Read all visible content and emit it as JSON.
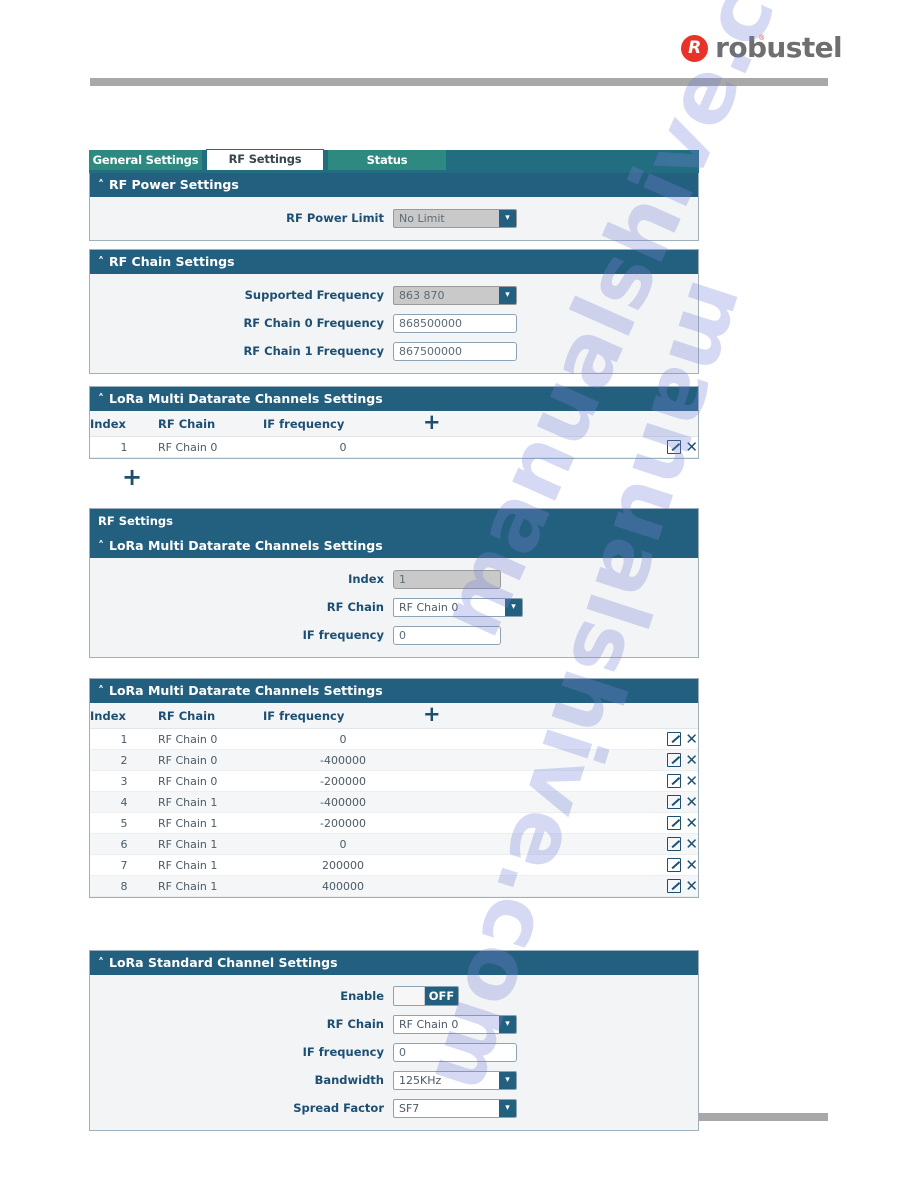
{
  "brand": {
    "name": "robustel",
    "mark_glyph": "R",
    "registered": "®"
  },
  "tabs": [
    {
      "label": "General Settings",
      "active": false
    },
    {
      "label": "RF Settings",
      "active": true
    },
    {
      "label": "Status",
      "active": false
    }
  ],
  "rf_power_settings": {
    "title": "RF Power Settings",
    "caret": "˄",
    "fields": [
      {
        "label": "RF Power Limit",
        "value": "No Limit",
        "type": "select",
        "disabled": true
      }
    ]
  },
  "rf_chain_settings": {
    "title": "RF Chain Settings",
    "caret": "˄",
    "fields": [
      {
        "label": "Supported Frequency",
        "value": "863 870",
        "type": "select",
        "disabled": true
      },
      {
        "label": "RF Chain 0 Frequency",
        "value": "868500000",
        "type": "text",
        "disabled": false
      },
      {
        "label": "RF Chain 1 Frequency",
        "value": "867500000",
        "type": "text",
        "disabled": false
      }
    ]
  },
  "multi_datarate_table_1": {
    "title": "LoRa Multi Datarate Channels Settings",
    "caret": "˄",
    "columns": [
      "Index",
      "RF Chain",
      "IF frequency"
    ],
    "rows": [
      {
        "index": "1",
        "rf_chain": "RF Chain 0",
        "if_frequency": "0"
      }
    ],
    "add_icon": "+",
    "edit_icon": "edit-icon",
    "delete_icon": "✕"
  },
  "standalone_add": {
    "icon": "+"
  },
  "dialog": {
    "title": "RF Settings",
    "panel_title": "LoRa Multi Datarate Channels Settings",
    "caret": "˄",
    "fields": [
      {
        "label": "Index",
        "value": "1",
        "type": "text",
        "disabled": true
      },
      {
        "label": "RF Chain",
        "value": "RF Chain 0",
        "type": "select",
        "disabled": false
      },
      {
        "label": "IF frequency",
        "value": "0",
        "type": "text",
        "disabled": false
      }
    ]
  },
  "multi_datarate_table_2": {
    "title": "LoRa Multi Datarate Channels Settings",
    "caret": "˄",
    "columns": [
      "Index",
      "RF Chain",
      "IF frequency"
    ],
    "rows": [
      {
        "index": "1",
        "rf_chain": "RF Chain 0",
        "if_frequency": "0"
      },
      {
        "index": "2",
        "rf_chain": "RF Chain 0",
        "if_frequency": "-400000"
      },
      {
        "index": "3",
        "rf_chain": "RF Chain 0",
        "if_frequency": "-200000"
      },
      {
        "index": "4",
        "rf_chain": "RF Chain 1",
        "if_frequency": "-400000"
      },
      {
        "index": "5",
        "rf_chain": "RF Chain 1",
        "if_frequency": "-200000"
      },
      {
        "index": "6",
        "rf_chain": "RF Chain 1",
        "if_frequency": "0"
      },
      {
        "index": "7",
        "rf_chain": "RF Chain 1",
        "if_frequency": "200000"
      },
      {
        "index": "8",
        "rf_chain": "RF Chain 1",
        "if_frequency": "400000"
      }
    ],
    "add_icon": "+",
    "delete_icon": "✕"
  },
  "standard_channel_settings": {
    "title": "LoRa Standard Channel Settings",
    "caret": "˄",
    "fields": [
      {
        "label": "Enable",
        "value": "OFF",
        "type": "toggle",
        "disabled": false
      },
      {
        "label": "RF Chain",
        "value": "RF Chain 0",
        "type": "select",
        "disabled": false
      },
      {
        "label": "IF frequency",
        "value": "0",
        "type": "text",
        "disabled": false
      },
      {
        "label": "Bandwidth",
        "value": "125KHz",
        "type": "select",
        "disabled": false
      },
      {
        "label": "Spread Factor",
        "value": "SF7",
        "type": "select",
        "disabled": false
      }
    ]
  },
  "watermark": {
    "text": "manualshive.com"
  },
  "colors": {
    "panel_header": "#23607f",
    "tab_inactive": "#2e8a80",
    "label_text": "#1d4f73",
    "brand_red": "#e8332a",
    "rule_grey": "#a8a8a8"
  }
}
